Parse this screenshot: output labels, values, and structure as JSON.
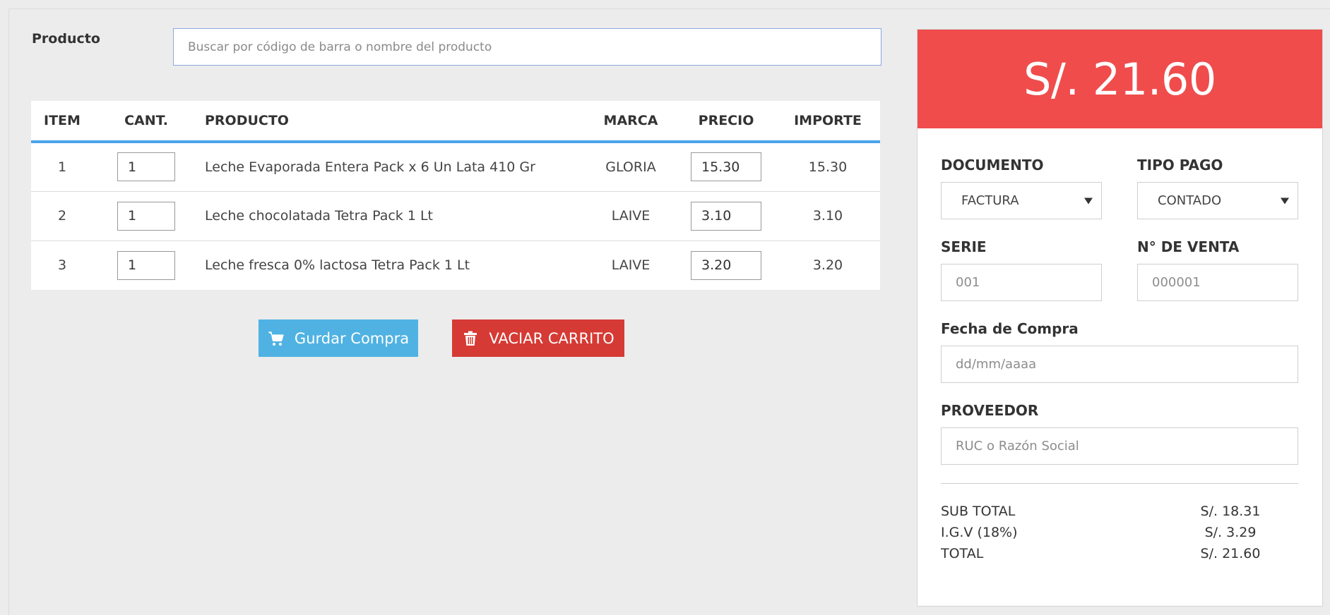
{
  "search": {
    "label": "Producto",
    "placeholder": "Buscar por código de barra o nombre del producto"
  },
  "table": {
    "headers": {
      "item": "ITEM",
      "qty": "CANT.",
      "product": "PRODUCTO",
      "brand": "MARCA",
      "price": "PRECIO",
      "amount": "IMPORTE"
    },
    "rows": [
      {
        "item": "1",
        "qty": "1",
        "product": "Leche Evaporada Entera Pack x 6 Un Lata 410 Gr",
        "brand": "GLORIA",
        "price": "15.30",
        "amount": "15.30"
      },
      {
        "item": "2",
        "qty": "1",
        "product": "Leche chocolatada Tetra Pack 1 Lt",
        "brand": "LAIVE",
        "price": "3.10",
        "amount": "3.10"
      },
      {
        "item": "3",
        "qty": "1",
        "product": "Leche fresca 0% lactosa Tetra Pack 1 Lt",
        "brand": "LAIVE",
        "price": "3.20",
        "amount": "3.20"
      }
    ]
  },
  "actions": {
    "save_label": "Gurdar Compra",
    "clear_label": "VACIAR CARRITO",
    "save_icon": "cart-icon",
    "clear_icon": "trash-icon"
  },
  "panel": {
    "total": "S/. 21.60",
    "document_label": "DOCUMENTO",
    "document_value": "FACTURA",
    "payment_label": "TIPO PAGO",
    "payment_value": "CONTADO",
    "series_label": "SERIE",
    "series_placeholder": "001",
    "sale_no_label": "N° DE VENTA",
    "sale_no_placeholder": "000001",
    "date_label": "Fecha de Compra",
    "date_placeholder": "dd/mm/aaaa",
    "supplier_label": "PROVEEDOR",
    "supplier_placeholder": "RUC o Razón Social",
    "summary": [
      {
        "label": "SUB TOTAL",
        "value": "S/. 18.31"
      },
      {
        "label": "I.G.V (18%)",
        "value": "S/. 3.29"
      },
      {
        "label": "TOTAL",
        "value": "S/. 21.60"
      }
    ]
  },
  "colors": {
    "accent_blue": "#4aa3ea",
    "save_button": "#4fb2e3",
    "clear_button": "#d63a34",
    "total_banner": "#f04c4c"
  }
}
